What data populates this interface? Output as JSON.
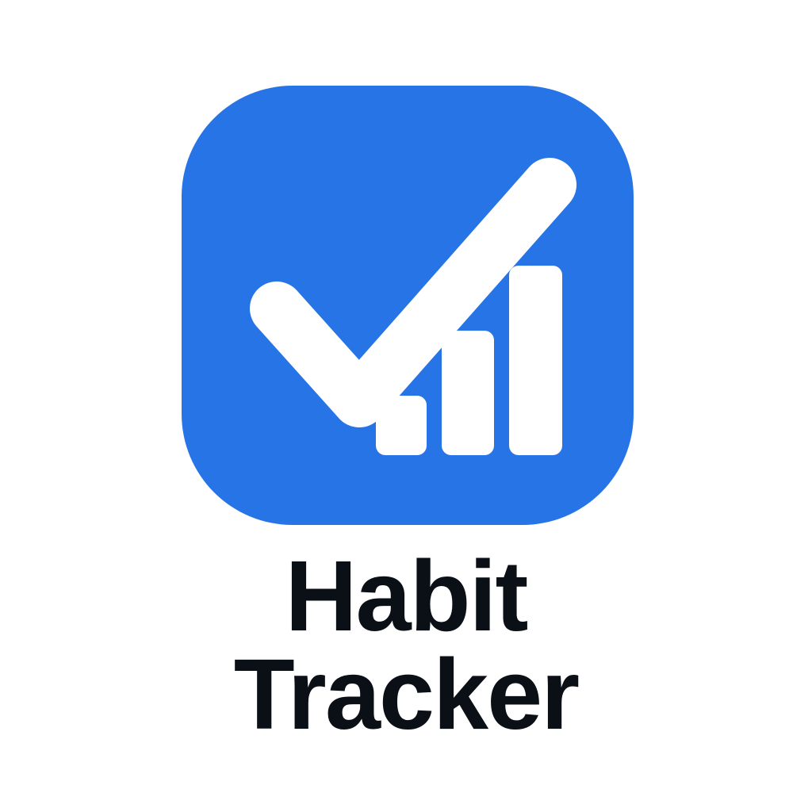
{
  "app": {
    "name_line1": "Habit",
    "name_line2": "Tracker"
  },
  "icons": {
    "app_icon": "checkmark-with-bar-chart-icon"
  },
  "colors": {
    "brand_blue": "#2674E6",
    "glyph_white": "#FFFFFF",
    "text_dark": "#0B0F16",
    "background": "#FFFFFF"
  }
}
